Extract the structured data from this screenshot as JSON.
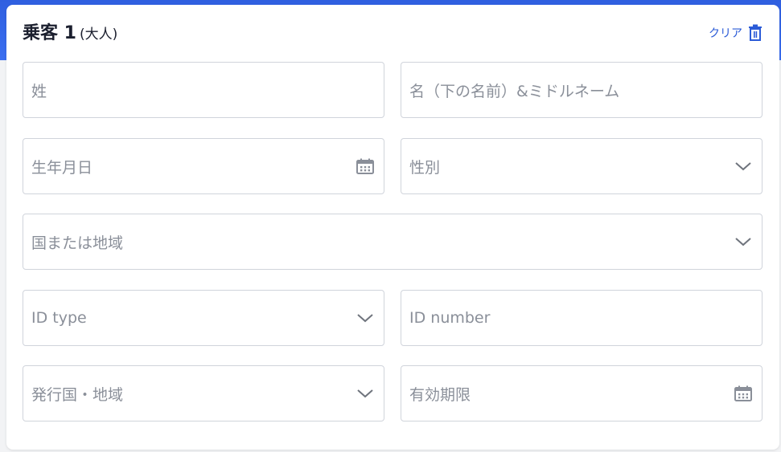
{
  "passenger": {
    "title": "乗客 1",
    "subtitle": "(大人)",
    "clear_label": "クリア"
  },
  "fields": {
    "last_name": {
      "placeholder": "姓"
    },
    "first_name": {
      "placeholder": "名（下の名前）&ミドルネーム"
    },
    "birth_date": {
      "placeholder": "生年月日",
      "icon": "calendar-icon"
    },
    "gender": {
      "placeholder": "性別",
      "icon": "chevron-down-icon"
    },
    "country": {
      "placeholder": "国または地域",
      "icon": "chevron-down-icon"
    },
    "id_type": {
      "placeholder": "ID type",
      "icon": "chevron-down-icon"
    },
    "id_number": {
      "placeholder": "ID number"
    },
    "issuing_country": {
      "placeholder": "発行国・地域",
      "icon": "chevron-down-icon"
    },
    "expiry_date": {
      "placeholder": "有効期限",
      "icon": "calendar-icon"
    }
  },
  "colors": {
    "accent": "#2b5bd7",
    "header_band": "#3a6ef0",
    "border": "#d0d4db",
    "placeholder": "#8a8f99",
    "title": "#1b1f2e"
  }
}
